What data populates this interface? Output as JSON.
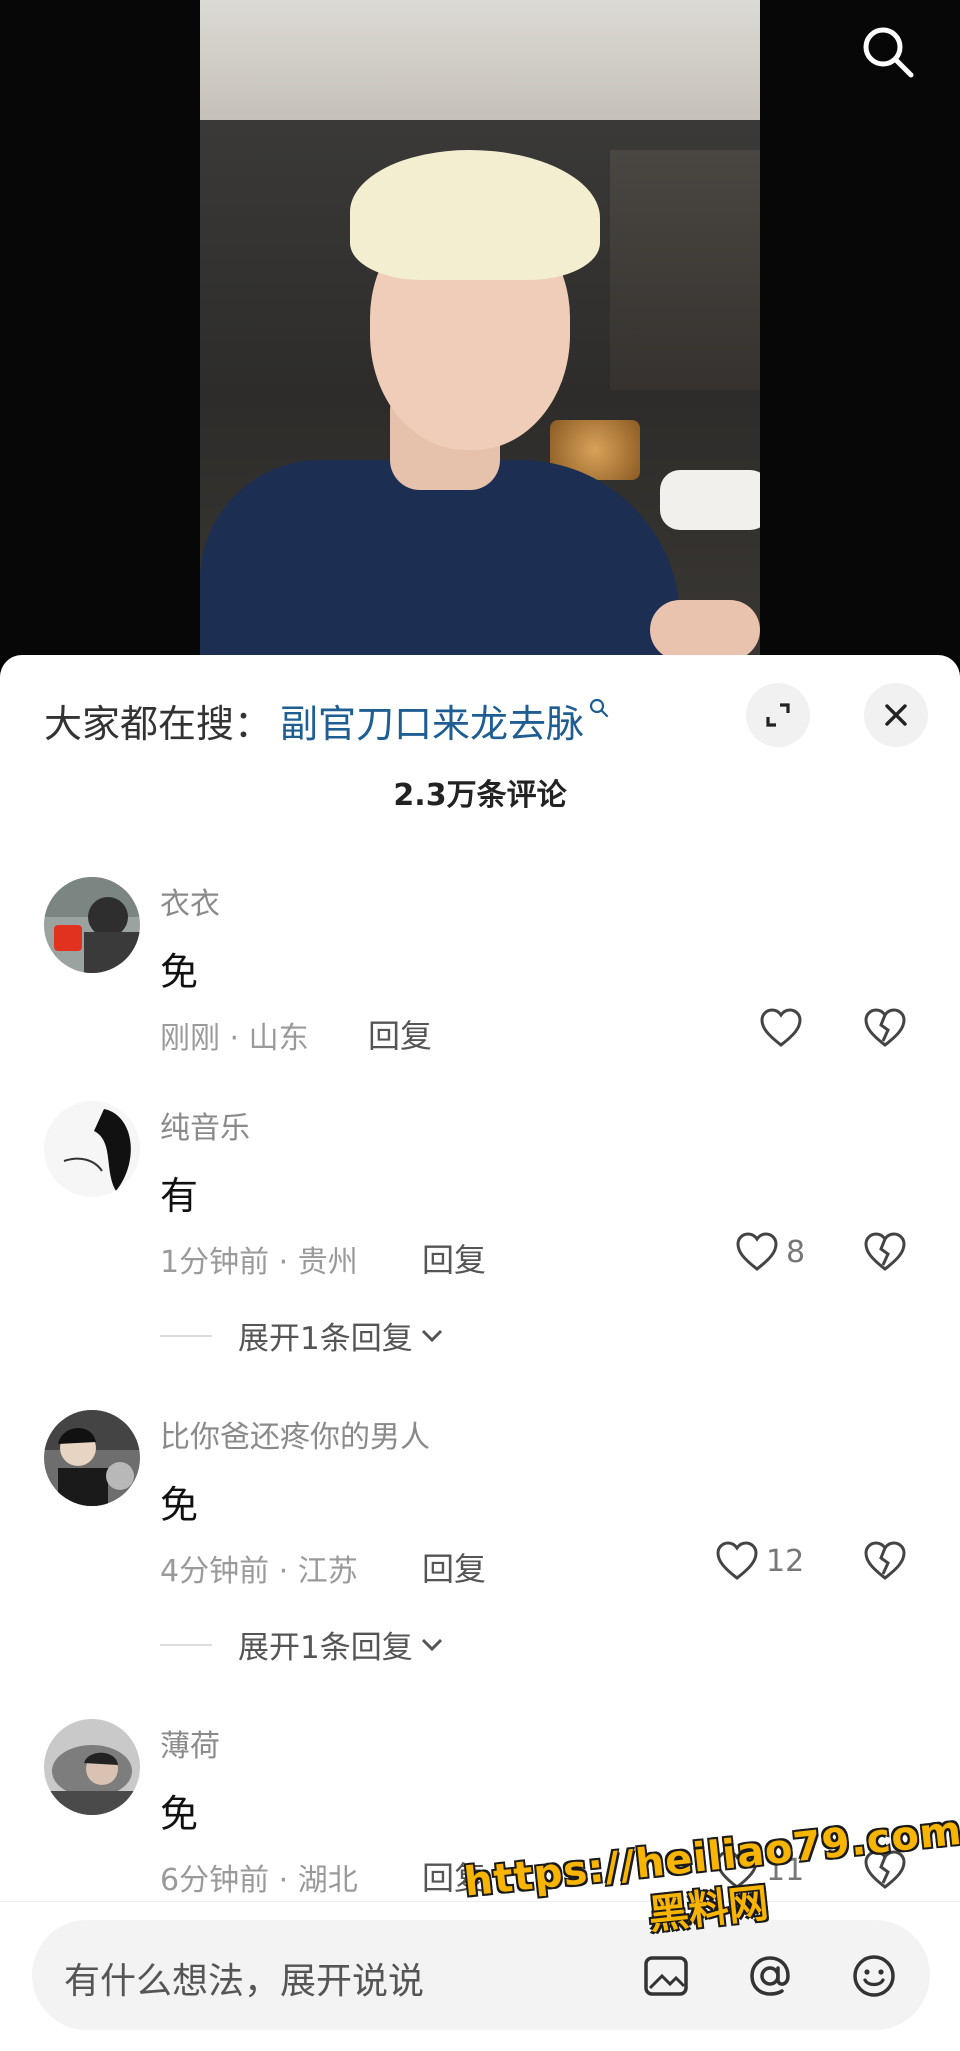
{
  "search_bar": {
    "prefix": "大家都在搜：",
    "term": "副官刀口来龙去脉"
  },
  "comments_count": "2.3万条评论",
  "comments": [
    {
      "user": "衣衣",
      "text": "免",
      "time_location": "刚刚 · 山东",
      "reply_label": "回复",
      "likes": ""
    },
    {
      "user": "纯音乐",
      "text": "有",
      "time_location": "1分钟前 · 贵州",
      "reply_label": "回复",
      "likes": "8",
      "expand_label": "展开1条回复"
    },
    {
      "user": "比你爸还疼你的男人",
      "text": "免",
      "time_location": "4分钟前 · 江苏",
      "reply_label": "回复",
      "likes": "12",
      "expand_label": "展开1条回复"
    },
    {
      "user": "薄荷",
      "text": "免",
      "time_location": "6分钟前 · 湖北",
      "reply_label": "回复",
      "likes": "11"
    }
  ],
  "input": {
    "placeholder": "有什么想法，展开说说"
  },
  "watermark": {
    "url": "https://heiliao79.com",
    "name": "黑料网"
  },
  "colors": {
    "accent_link": "#1e5e92",
    "watermark": "#f7b400"
  }
}
